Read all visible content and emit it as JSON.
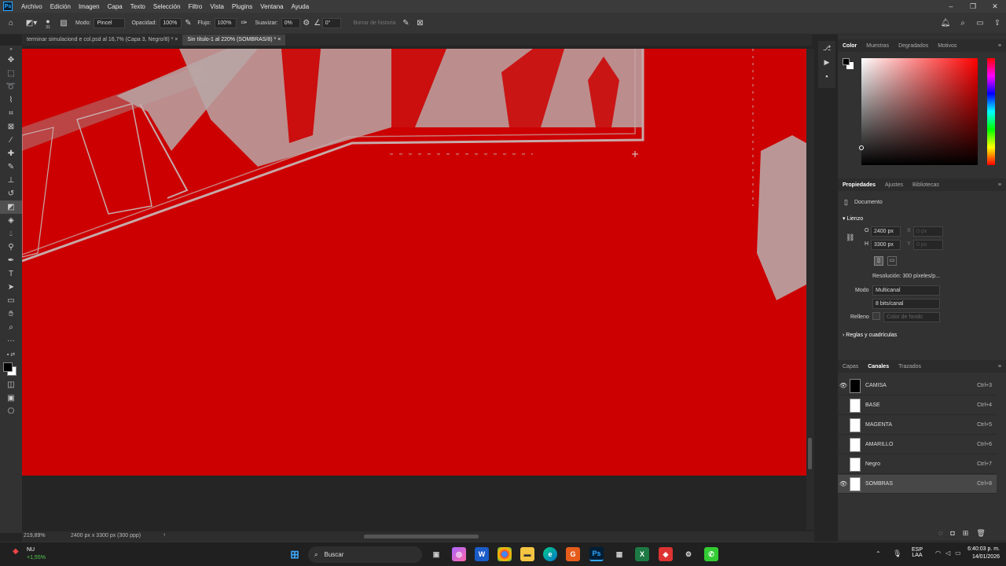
{
  "menubar": {
    "logo": "Ps",
    "items": [
      "Archivo",
      "Edición",
      "Imagen",
      "Capa",
      "Texto",
      "Selección",
      "Filtro",
      "Vista",
      "Plugins",
      "Ventana",
      "Ayuda"
    ]
  },
  "options": {
    "brush_size": "31",
    "mode_label": "Modo:",
    "mode_value": "Pincel",
    "opacity_label": "Opacidad:",
    "opacity_value": "100%",
    "flow_label": "Flujo:",
    "flow_value": "100%",
    "smooth_label": "Suavizar:",
    "smooth_value": "0%",
    "angle_value": "0°",
    "erase_history": "Borrar de historia"
  },
  "tabs": [
    {
      "label": "terminar simulaciond e col.psd al 16,7% (Capa 3, Negro/8) *"
    },
    {
      "label": "Sin título-1 al 220% (SOMBRAS/8) *"
    }
  ],
  "status": {
    "zoom": "219,89%",
    "doc_size": "2400 px x 3300 px (300 ppp)"
  },
  "color_panel": {
    "tabs": [
      "Color",
      "Muestras",
      "Degradados",
      "Motivos"
    ]
  },
  "properties": {
    "tabs": [
      "Propiedades",
      "Ajustes",
      "Bibliotecas"
    ],
    "doc_label": "Documento",
    "section_canvas": "Lienzo",
    "w_label": "O",
    "w_value": "2400 px",
    "x_label": "X",
    "x_value": "0 px",
    "h_label": "H",
    "h_value": "3300 px",
    "y_label": "Y",
    "y_value": "0 px",
    "resolution": "Resolución: 300 píxeles/p...",
    "mode_label": "Modo",
    "mode_value": "Multicanal",
    "bits_value": "8 bits/canal",
    "fill_label": "Relleno",
    "fill_value": "Color de fondo",
    "section_rules": "Reglas y cuadrículas"
  },
  "channels": {
    "tabs": [
      "Capas",
      "Canales",
      "Trazados"
    ],
    "items": [
      {
        "name": "CAMISA",
        "key": "Ctrl+3"
      },
      {
        "name": "BASE",
        "key": "Ctrl+4"
      },
      {
        "name": "MAGENTA",
        "key": "Ctrl+5"
      },
      {
        "name": "AMARILLO",
        "key": "Ctrl+6"
      },
      {
        "name": "Negro",
        "key": "Ctrl+7"
      },
      {
        "name": "SOMBRAS",
        "key": "Ctrl+8"
      }
    ]
  },
  "taskbar": {
    "weather_title": "NU",
    "weather_value": "+1,55%",
    "search_label": "Buscar",
    "lang_top": "ESP",
    "lang_bottom": "LAA",
    "time": "6:40:03 p. m.",
    "date": "14/01/2026"
  },
  "colors": {
    "canvas": "#cc0000",
    "accent": "#31a8ff"
  }
}
